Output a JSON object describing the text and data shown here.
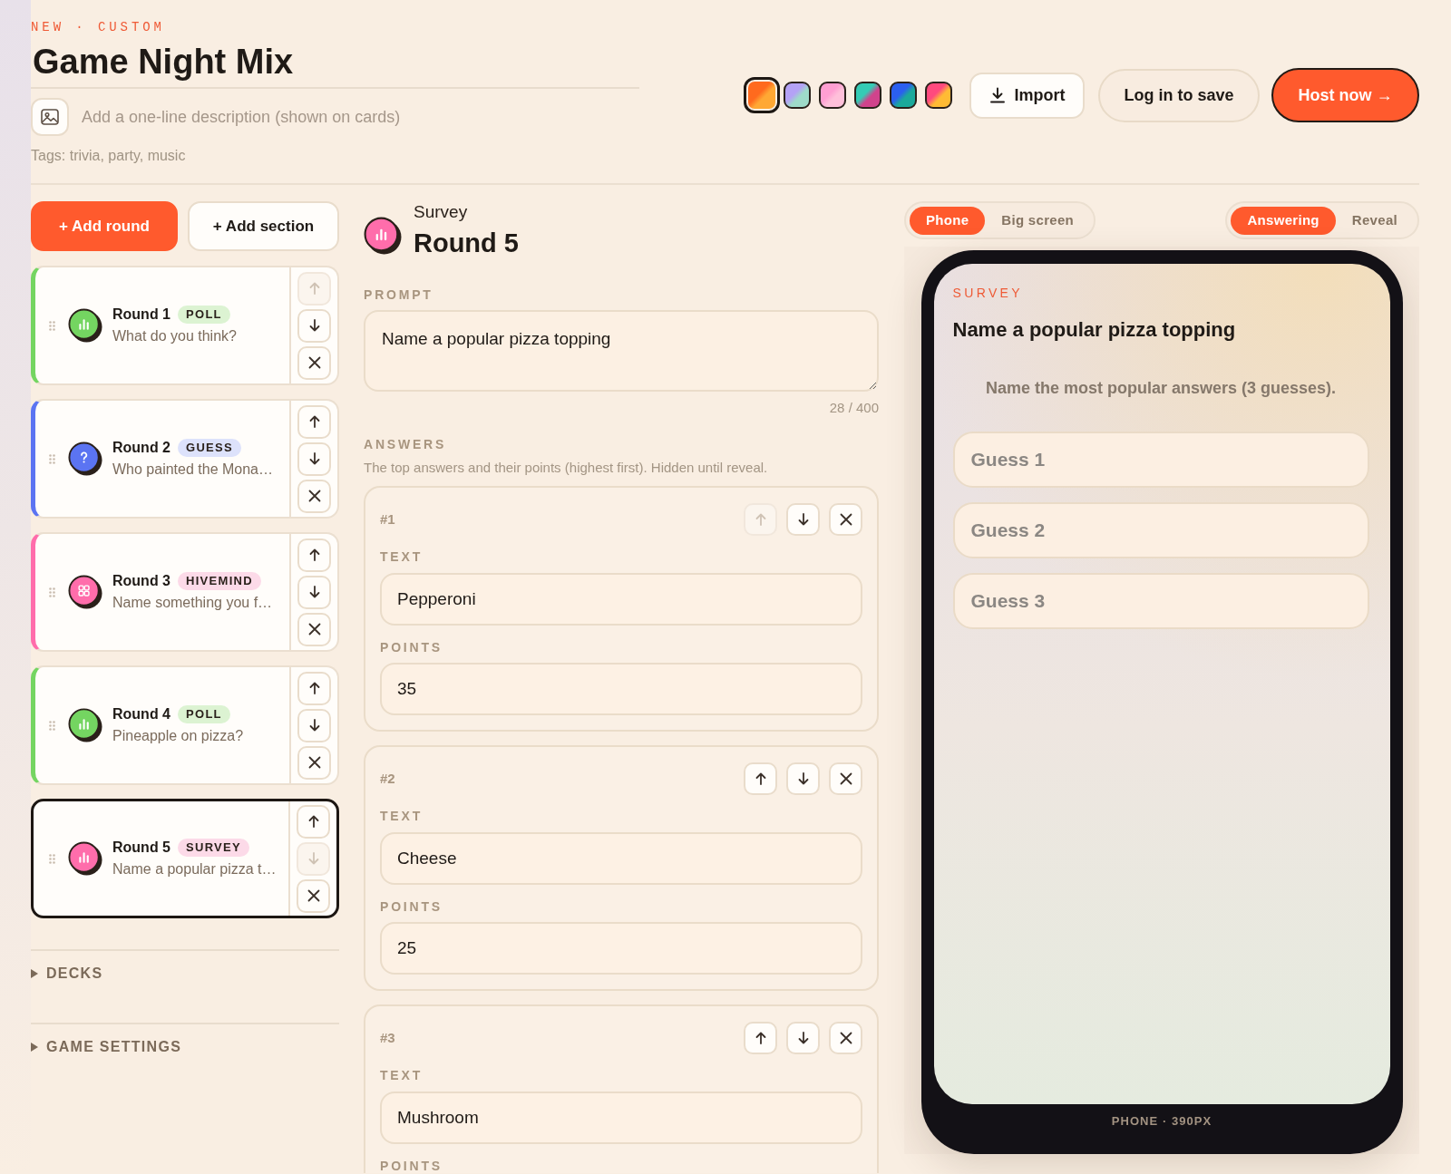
{
  "header": {
    "eyebrow": "NEW · CUSTOM",
    "title": "Game Night Mix",
    "description": {
      "placeholder": "Add a one-line description (shown on cards)"
    },
    "tags": "Tags: trivia, party, music"
  },
  "themes": [
    {
      "stops": [
        {
          "color": "#ff6a1e"
        },
        {
          "color": "#ffa834"
        }
      ],
      "selected": true
    },
    {
      "stops": [
        {
          "color": "#b4a2f6"
        },
        {
          "color": "#9edbc9"
        }
      ],
      "selected": false
    },
    {
      "stops": [
        {
          "color": "#ff9fd2"
        },
        {
          "color": "#ffc0da"
        }
      ],
      "selected": false
    },
    {
      "stops": [
        {
          "color": "#35cbb5"
        },
        {
          "color": "#d0438c"
        }
      ],
      "selected": false
    },
    {
      "stops": [
        {
          "color": "#2b5ff0"
        },
        {
          "color": "#1ba99b"
        }
      ],
      "selected": false
    },
    {
      "stops": [
        {
          "color": "#ff4a7e"
        },
        {
          "color": "#ffbb34"
        }
      ],
      "selected": false
    }
  ],
  "actions": [
    {
      "label": "Import",
      "kind": "import"
    },
    {
      "label": "Log in to save",
      "kind": "secondary"
    },
    {
      "label": "Host now →",
      "kind": "primary"
    }
  ],
  "sidebar": {
    "buttons": [
      {
        "label": "+ Add round",
        "kind": "primary"
      },
      {
        "label": "+ Add section",
        "kind": "secondary"
      }
    ],
    "rounds": [
      {
        "title": "Round 1",
        "badge": "POLL",
        "kind": "poll",
        "subtitle": "What do you think?",
        "color": "#74d561",
        "selected": false,
        "up_disabled": true,
        "down_disabled": false
      },
      {
        "title": "Round 2",
        "badge": "GUESS",
        "kind": "guess",
        "subtitle": "Who painted the Mona…",
        "color": "#5b74f2",
        "selected": false,
        "up_disabled": false,
        "down_disabled": false
      },
      {
        "title": "Round 3",
        "badge": "HIVEMIND",
        "kind": "hivemind",
        "subtitle": "Name something you f…",
        "color": "#ff6dab",
        "selected": false,
        "up_disabled": false,
        "down_disabled": false
      },
      {
        "title": "Round 4",
        "badge": "POLL",
        "kind": "poll",
        "subtitle": "Pineapple on pizza?",
        "color": "#74d561",
        "selected": false,
        "up_disabled": false,
        "down_disabled": false
      },
      {
        "title": "Round 5",
        "badge": "SURVEY",
        "kind": "survey",
        "subtitle": "Name a popular pizza t…",
        "color": "#ff6dab",
        "selected": true,
        "up_disabled": false,
        "down_disabled": true
      }
    ],
    "sections": [
      {
        "label": "DECKS",
        "expanded": false
      },
      {
        "label": "GAME SETTINGS",
        "expanded": false
      }
    ]
  },
  "editor": {
    "type_label": "Survey",
    "title": "Round 5",
    "kind": "survey",
    "color": "#ff6dab",
    "prompt_label": "PROMPT",
    "prompt": "Name a popular pizza topping",
    "char_count": "28 / 400",
    "answers_label": "ANSWERS",
    "answers_hint": "The top answers and their points (highest first). Hidden until reveal.",
    "answers": [
      {
        "number": "#1",
        "text_label": "TEXT",
        "text": "Pepperoni",
        "points_label": "POINTS",
        "points": "35",
        "up_disabled": true,
        "down_disabled": false
      },
      {
        "number": "#2",
        "text_label": "TEXT",
        "text": "Cheese",
        "points_label": "POINTS",
        "points": "25",
        "up_disabled": false,
        "down_disabled": false
      },
      {
        "number": "#3",
        "text_label": "TEXT",
        "text": "Mushroom",
        "points_label": "POINTS",
        "up_disabled": false,
        "down_disabled": false
      }
    ]
  },
  "preview": {
    "device_tabs": [
      {
        "label": "Phone",
        "selected": true
      },
      {
        "label": "Big screen",
        "selected": false
      }
    ],
    "mode_tabs": [
      {
        "label": "Answering",
        "selected": true
      },
      {
        "label": "Reveal",
        "selected": false
      }
    ],
    "screen": {
      "eyebrow": "SURVEY",
      "question": "Name a popular pizza topping",
      "instruction": "Name the most popular answers (3 guesses).",
      "guesses": [
        {
          "placeholder": "Guess 1"
        },
        {
          "placeholder": "Guess 2"
        },
        {
          "placeholder": "Guess 3"
        }
      ]
    },
    "device_label": "PHONE · 390PX"
  }
}
